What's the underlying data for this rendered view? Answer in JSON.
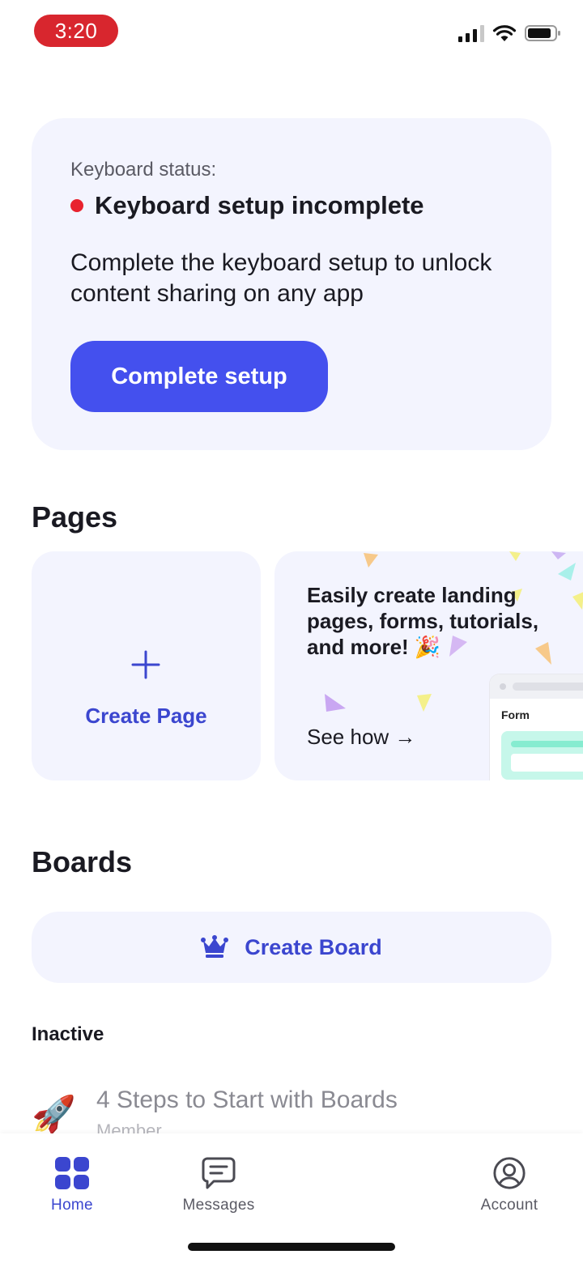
{
  "status_bar": {
    "time": "3:20",
    "time_pill_color": "#d8262e",
    "icons": [
      "signal-icon",
      "wifi-icon",
      "battery-icon"
    ]
  },
  "keyboard_card": {
    "status_label": "Keyboard status:",
    "status_value": "Keyboard setup incomplete",
    "status_dot_color": "#e8222e",
    "description": "Complete the keyboard setup to unlock content sharing on any app",
    "button_label": "Complete setup",
    "accent_color": "#4450ee"
  },
  "pages": {
    "title": "Pages",
    "create_card": {
      "label": "Create Page",
      "icon": "plus-icon"
    },
    "promo_card": {
      "text": "Easily create landing pages, forms, tutorials, and more! 🎉",
      "link_label": "See how →",
      "mock_form_label": "Form"
    }
  },
  "boards": {
    "title": "Boards",
    "create_button": {
      "label": "Create Board",
      "icon": "crown-icon"
    },
    "inactive_label": "Inactive",
    "items": [
      {
        "icon": "🚀",
        "title": "4 Steps to Start with Boards",
        "subtitle": "Member"
      }
    ]
  },
  "tabbar": {
    "tabs": [
      {
        "label": "Home",
        "icon": "home-grid-icon",
        "active": true
      },
      {
        "label": "Messages",
        "icon": "message-icon",
        "active": false
      },
      {
        "label": "Account",
        "icon": "account-icon",
        "active": false
      }
    ],
    "active_color": "#3b46cf"
  }
}
